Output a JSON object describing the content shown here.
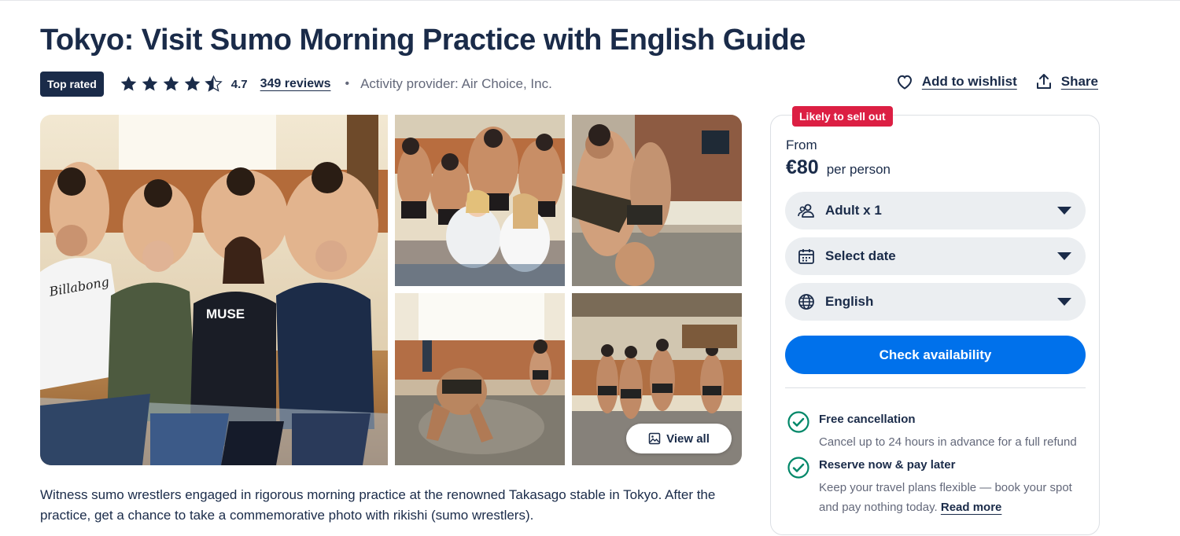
{
  "header": {
    "title": "Tokyo: Visit Sumo Morning Practice with English Guide",
    "badge": "Top rated",
    "rating": "4.7",
    "reviews": "349 reviews",
    "separator": "•",
    "provider": "Activity provider: Air Choice, Inc."
  },
  "actions": {
    "wishlist": "Add to wishlist",
    "share": "Share"
  },
  "gallery": {
    "view_all": "View all",
    "main_shirt_text": "MUSE",
    "hoodie_text": "Billabong"
  },
  "description": "Witness sumo wrestlers engaged in rigorous morning practice at the renowned Takasago stable in Tokyo. After the practice, get a chance to take a commemorative photo with rikishi (sumo wrestlers).",
  "booking": {
    "sell_badge": "Likely to sell out",
    "from": "From",
    "price": "€80",
    "per_person": "per person",
    "participants": "Adult x 1",
    "date": "Select date",
    "language": "English",
    "cta": "Check availability",
    "features": [
      {
        "title": "Free cancellation",
        "text": "Cancel up to 24 hours in advance for a full refund"
      },
      {
        "title": "Reserve now & pay later",
        "text": "Keep your travel plans flexible — book your spot and pay nothing today.",
        "link": "Read more"
      }
    ]
  },
  "colors": {
    "navy": "#1a2b49",
    "primary": "#0071eb",
    "alert": "#dc1f43",
    "success": "#008768",
    "muted": "#63687a"
  },
  "icons": [
    "star-icon",
    "half-star-icon",
    "heart-icon",
    "share-icon",
    "image-icon",
    "participants-icon",
    "calendar-icon",
    "globe-icon",
    "check-circle-icon"
  ]
}
